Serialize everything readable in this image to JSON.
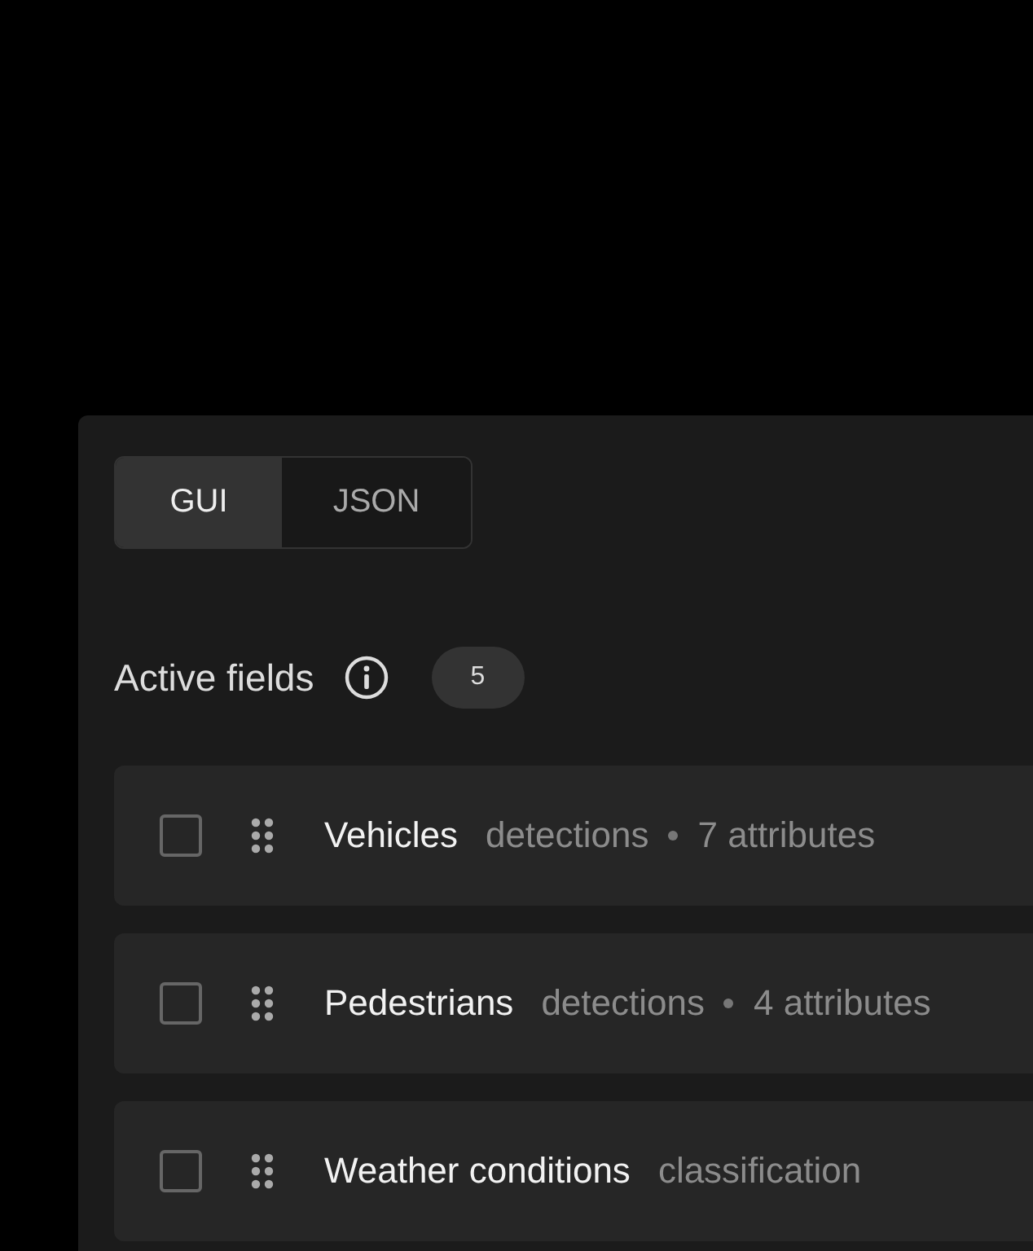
{
  "tabs": [
    {
      "label": "GUI",
      "selected": true
    },
    {
      "label": "JSON",
      "selected": false
    }
  ],
  "section": {
    "title": "Active fields",
    "count": "5"
  },
  "fields": [
    {
      "name": "Vehicles",
      "type": "detections",
      "attributes": "7 attributes",
      "checked": false
    },
    {
      "name": "Pedestrians",
      "type": "detections",
      "attributes": "4 attributes",
      "checked": false
    },
    {
      "name": "Weather conditions",
      "type": "classification",
      "checked": false
    }
  ]
}
